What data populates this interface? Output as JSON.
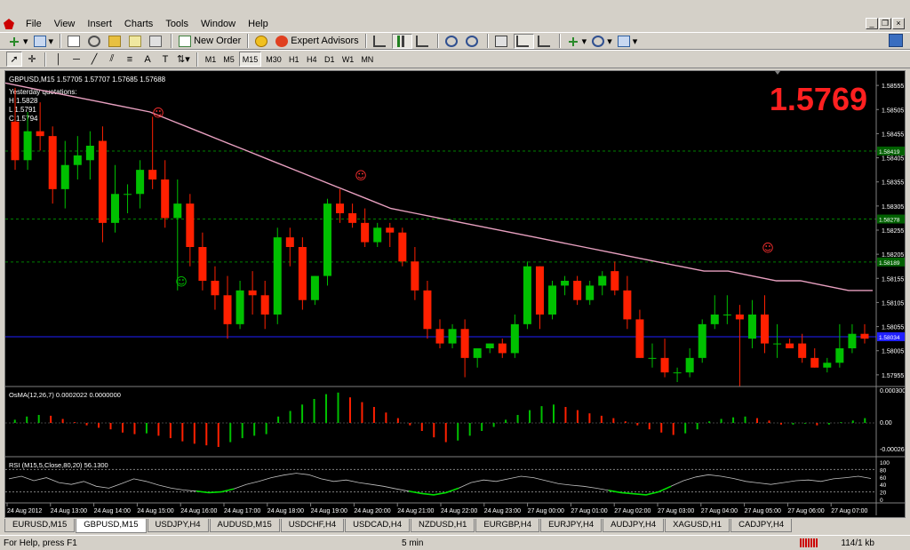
{
  "menu": {
    "items": [
      "File",
      "View",
      "Insert",
      "Charts",
      "Tools",
      "Window",
      "Help"
    ]
  },
  "toolbar": {
    "new_order": "New Order",
    "expert_advisors": "Expert Advisors",
    "timeframes": [
      "M1",
      "M5",
      "M15",
      "M30",
      "H1",
      "H4",
      "D1",
      "W1",
      "MN"
    ],
    "active_timeframe": "M15"
  },
  "chart": {
    "header": "GBPUSD,M15  1.57705 1.57707 1.57685 1.57688",
    "yesterday_title": "Yesterday quotations:",
    "yesterday_h": "H 1.5828",
    "yesterday_l": "L 1.5791",
    "yesterday_c": "C 1.5794",
    "big_price": "1.5769",
    "price_axis": [
      "1.58555",
      "1.58505",
      "1.58455",
      "1.58405",
      "1.58355",
      "1.58305",
      "1.58255",
      "1.58205",
      "1.58155",
      "1.58105",
      "1.58055",
      "1.58005",
      "1.57955"
    ],
    "level_labels": [
      "1.58419",
      "1.58278",
      "1.58189",
      "1.58034"
    ],
    "osma_header": "OsMA(12,26,7) 0.0002022 0.0000000",
    "osma_axis": [
      "0.000300",
      "0.00",
      "-0.00026"
    ],
    "rsi_header": "RSI (M15,5,Close,80,20) 56.1300",
    "rsi_axis": [
      "100",
      "80",
      "60",
      "40",
      "20",
      "0"
    ],
    "time_axis": [
      "24 Aug 2012",
      "24 Aug 13:00",
      "24 Aug 14:00",
      "24 Aug 15:00",
      "24 Aug 16:00",
      "24 Aug 17:00",
      "24 Aug 18:00",
      "24 Aug 19:00",
      "24 Aug 20:00",
      "24 Aug 21:00",
      "24 Aug 22:00",
      "24 Aug 23:00",
      "27 Aug 00:00",
      "27 Aug 01:00",
      "27 Aug 02:00",
      "27 Aug 03:00",
      "27 Aug 04:00",
      "27 Aug 05:00",
      "27 Aug 06:00",
      "27 Aug 07:00"
    ],
    "colors": {
      "bull": "#00c000",
      "bear": "#ff2000",
      "ma": "#e8a0c0",
      "price_line": "#2020ff",
      "grid": "#008000",
      "big_price": "#ff2020"
    }
  },
  "chart_data": {
    "type": "candlestick",
    "candles": [
      [
        1.5848,
        1.5855,
        1.5838,
        1.584
      ],
      [
        1.584,
        1.585,
        1.5838,
        1.5846
      ],
      [
        1.5846,
        1.5852,
        1.5842,
        1.5845
      ],
      [
        1.5845,
        1.5847,
        1.5831,
        1.5834
      ],
      [
        1.5834,
        1.5844,
        1.583,
        1.5839
      ],
      [
        1.5839,
        1.5845,
        1.5836,
        1.5841
      ],
      [
        1.584,
        1.5846,
        1.5836,
        1.5843
      ],
      [
        1.5844,
        1.5847,
        1.5823,
        1.5827
      ],
      [
        1.5827,
        1.5839,
        1.5825,
        1.5833
      ],
      [
        1.5833,
        1.5835,
        1.5829,
        1.5833
      ],
      [
        1.5833,
        1.584,
        1.583,
        1.5838
      ],
      [
        1.5838,
        1.5849,
        1.5834,
        1.5836
      ],
      [
        1.5836,
        1.584,
        1.5826,
        1.5828
      ],
      [
        1.5828,
        1.5836,
        1.5813,
        1.5831
      ],
      [
        1.5831,
        1.5833,
        1.5818,
        1.5822
      ],
      [
        1.5822,
        1.5825,
        1.5813,
        1.5815
      ],
      [
        1.5815,
        1.5818,
        1.5809,
        1.5812
      ],
      [
        1.5812,
        1.5816,
        1.5803,
        1.5806
      ],
      [
        1.5806,
        1.5815,
        1.5805,
        1.5813
      ],
      [
        1.5813,
        1.5817,
        1.5808,
        1.5812
      ],
      [
        1.5812,
        1.5815,
        1.5805,
        1.5808
      ],
      [
        1.5808,
        1.5826,
        1.5806,
        1.5824
      ],
      [
        1.5824,
        1.5826,
        1.5818,
        1.5822
      ],
      [
        1.5822,
        1.5824,
        1.5809,
        1.5811
      ],
      [
        1.5811,
        1.5816,
        1.581,
        1.5816
      ],
      [
        1.5816,
        1.5832,
        1.5814,
        1.5831
      ],
      [
        1.5831,
        1.5834,
        1.5827,
        1.5829
      ],
      [
        1.5829,
        1.5831,
        1.5826,
        1.5827
      ],
      [
        1.5827,
        1.583,
        1.5822,
        1.5823
      ],
      [
        1.5823,
        1.5827,
        1.5822,
        1.5826
      ],
      [
        1.5826,
        1.5827,
        1.5822,
        1.5825
      ],
      [
        1.5825,
        1.5826,
        1.5818,
        1.5819
      ],
      [
        1.5819,
        1.5822,
        1.5811,
        1.5813
      ],
      [
        1.5813,
        1.5815,
        1.5803,
        1.5805
      ],
      [
        1.5805,
        1.5807,
        1.5801,
        1.5802
      ],
      [
        1.5802,
        1.5806,
        1.5801,
        1.5805
      ],
      [
        1.5805,
        1.5807,
        1.5795,
        1.5799
      ],
      [
        1.5799,
        1.5801,
        1.5797,
        1.5801
      ],
      [
        1.5801,
        1.5802,
        1.58,
        1.5802
      ],
      [
        1.5802,
        1.5803,
        1.5799,
        1.58
      ],
      [
        1.58,
        1.5808,
        1.5799,
        1.5806
      ],
      [
        1.5806,
        1.5819,
        1.5805,
        1.5818
      ],
      [
        1.5818,
        1.5818,
        1.5805,
        1.5808
      ],
      [
        1.5808,
        1.5815,
        1.5807,
        1.5814
      ],
      [
        1.5814,
        1.5816,
        1.5812,
        1.5815
      ],
      [
        1.5815,
        1.5816,
        1.581,
        1.5811
      ],
      [
        1.5811,
        1.5815,
        1.581,
        1.5814
      ],
      [
        1.5814,
        1.5817,
        1.5812,
        1.5816
      ],
      [
        1.5817,
        1.5819,
        1.5812,
        1.5813
      ],
      [
        1.5813,
        1.5816,
        1.5805,
        1.5807
      ],
      [
        1.5807,
        1.5809,
        1.5799,
        1.5799
      ],
      [
        1.5799,
        1.5802,
        1.5797,
        1.5799
      ],
      [
        1.5799,
        1.5803,
        1.5795,
        1.5796
      ],
      [
        1.5796,
        1.5797,
        1.5794,
        1.5796
      ],
      [
        1.5796,
        1.5801,
        1.5795,
        1.5799
      ],
      [
        1.5799,
        1.5807,
        1.5798,
        1.5806
      ],
      [
        1.5806,
        1.5812,
        1.5805,
        1.5808
      ],
      [
        1.5808,
        1.5812,
        1.5806,
        1.5808
      ],
      [
        1.5808,
        1.581,
        1.5793,
        1.5807
      ],
      [
        1.5803,
        1.5811,
        1.5801,
        1.5808
      ],
      [
        1.5808,
        1.5812,
        1.58,
        1.5802
      ],
      [
        1.5802,
        1.5806,
        1.5799,
        1.5802
      ],
      [
        1.5802,
        1.5803,
        1.5801,
        1.5801
      ],
      [
        1.5802,
        1.5804,
        1.5798,
        1.5799
      ],
      [
        1.5799,
        1.5801,
        1.5797,
        1.5797
      ],
      [
        1.5797,
        1.5799,
        1.5796,
        1.5798
      ],
      [
        1.5798,
        1.5806,
        1.5797,
        1.5801
      ],
      [
        1.5801,
        1.5806,
        1.58,
        1.5804
      ],
      [
        1.5804,
        1.5806,
        1.5802,
        1.5803
      ]
    ],
    "ma": [
      1.5856,
      1.5855,
      1.5854,
      1.5853,
      1.5852,
      1.5851,
      1.585,
      1.5848,
      1.5846,
      1.5844,
      1.5842,
      1.584,
      1.5838,
      1.5836,
      1.5834,
      1.5832,
      1.583,
      1.5829,
      1.5828,
      1.5827,
      1.5826,
      1.5825,
      1.5824,
      1.5823,
      1.5822,
      1.5821,
      1.582,
      1.5819,
      1.5818,
      1.5817,
      1.5817,
      1.5816,
      1.5815,
      1.5815,
      1.5814,
      1.5813,
      1.5813
    ],
    "osma": [
      0.4,
      0.8,
      1.0,
      0.9,
      0.5,
      0.1,
      -0.3,
      -0.6,
      -0.8,
      -1.2,
      -1.4,
      -1.3,
      -1.6,
      -1.9,
      -2.3,
      -2.6,
      -2.8,
      -3.0,
      -2.4,
      -1.9,
      -1.6,
      -1.4,
      0.8,
      1.5,
      2.3,
      3.0,
      3.6,
      3.8,
      3.2,
      2.6,
      2.0,
      1.3,
      0.6,
      -0.3,
      -1.0,
      -1.8,
      -2.4,
      -2.2,
      -1.6,
      -1.0,
      -0.5,
      0.4,
      1.0,
      1.6,
      2.1,
      2.3,
      2.0,
      1.6,
      1.2,
      0.9,
      0.6,
      0.2,
      -0.3,
      -0.8,
      -1.2,
      -1.5,
      -1.3,
      -0.8,
      0.2,
      0.5,
      0.7,
      0.8,
      0.6,
      0.3,
      -0.2,
      -0.2,
      -0.1,
      -0.3,
      -0.2,
      0.1,
      0.3,
      0.6
    ],
    "rsi": [
      55,
      62,
      50,
      58,
      45,
      40,
      48,
      35,
      30,
      42,
      55,
      48,
      38,
      30,
      25,
      22,
      18,
      20,
      28,
      40,
      48,
      58,
      65,
      70,
      66,
      55,
      48,
      52,
      45,
      40,
      35,
      28,
      22,
      16,
      12,
      18,
      30,
      45,
      52,
      48,
      55,
      62,
      58,
      50,
      42,
      38,
      35,
      30,
      24,
      18,
      15,
      12,
      20,
      35,
      50,
      60,
      66,
      62,
      56,
      48,
      44,
      40,
      45,
      50,
      52,
      48,
      55,
      58,
      62,
      56
    ]
  },
  "tabs": [
    "EURUSD,M15",
    "GBPUSD,M15",
    "USDJPY,H4",
    "AUDUSD,M15",
    "USDCHF,H4",
    "USDCAD,H4",
    "NZDUSD,H1",
    "EURGBP,H4",
    "EURJPY,H4",
    "AUDJPY,H4",
    "XAGUSD,H1",
    "CADJPY,H4"
  ],
  "active_tab": "GBPUSD,M15",
  "status": {
    "help": "For Help, press F1",
    "timeframe": "5 min",
    "traffic": "114/1 kb"
  }
}
